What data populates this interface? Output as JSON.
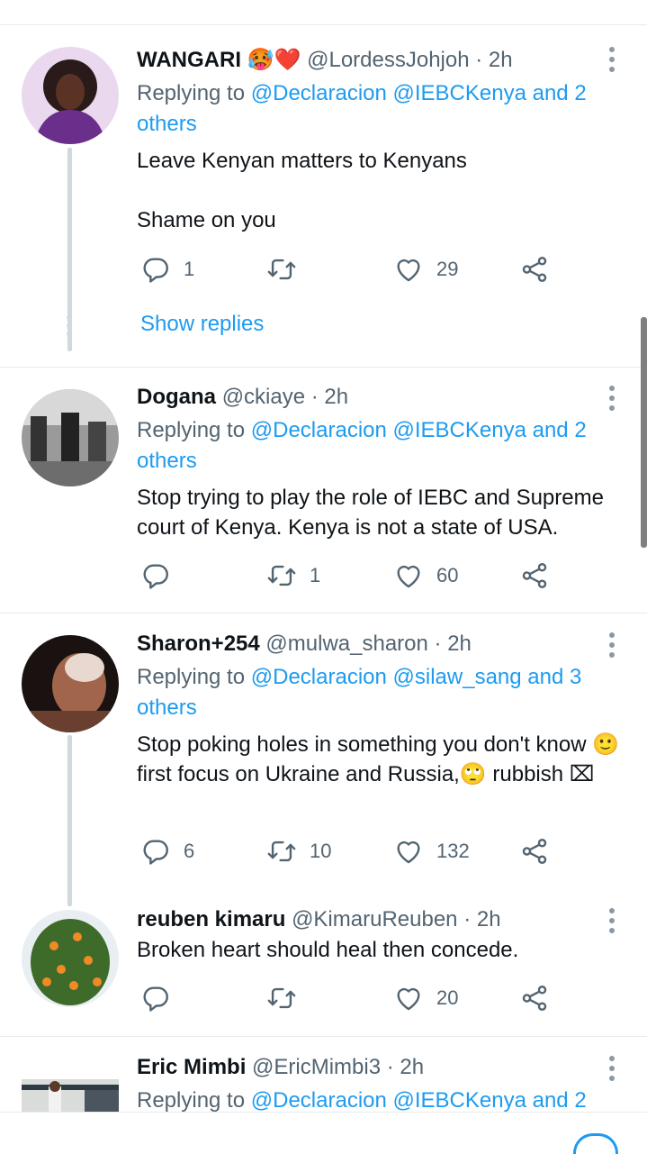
{
  "tweets": [
    {
      "name": "WANGARI",
      "emojis": "🥵❤️",
      "handle": "@LordessJohjoh",
      "time": "· 2h",
      "reply_prefix": "Replying to ",
      "reply_mentions": "@Declaracion @IEBCKenya and 2 others",
      "text_line1": "Leave Kenyan matters to Kenyans",
      "text_line2": "Shame on you",
      "replies": "1",
      "retweets": "",
      "likes": "29",
      "show_replies": "Show replies"
    },
    {
      "name": "Dogana",
      "handle": "@ckiaye",
      "time": "· 2h",
      "reply_prefix": "Replying to ",
      "reply_mentions": "@Declaracion @IEBCKenya and 2 others",
      "text": "Stop trying to play the role of IEBC and Supreme court of Kenya. Kenya is not a state of USA.",
      "replies": "",
      "retweets": "1",
      "likes": "60"
    },
    {
      "name": "Sharon+254",
      "handle": "@mulwa_sharon",
      "time": "· 2h",
      "reply_prefix": "Replying to ",
      "reply_mentions": "@Declaracion @silaw_sang and 3 others",
      "text": "Stop poking holes in something you don't know 🙂 first focus on Ukraine and Russia,🙄 rubbish ⌧",
      "replies": "6",
      "retweets": "10",
      "likes": "132"
    },
    {
      "name": "reuben kimaru",
      "handle": "@KimaruReuben",
      "time": "· 2h",
      "text": "Broken heart should heal then concede.",
      "replies": "",
      "retweets": "",
      "likes": "20"
    },
    {
      "name": "Eric Mimbi",
      "handle": "@EricMimbi3",
      "time": "· 2h",
      "reply_prefix": "Replying to ",
      "reply_mentions": "@Declaracion @IEBCKenya and 2"
    }
  ],
  "colors": {
    "accent": "#1d9bf0",
    "muted": "#536471",
    "text": "#0f1419",
    "thread": "#cfd9de"
  },
  "icons": [
    "reply-icon",
    "retweet-icon",
    "like-icon",
    "share-icon",
    "more-icon"
  ]
}
